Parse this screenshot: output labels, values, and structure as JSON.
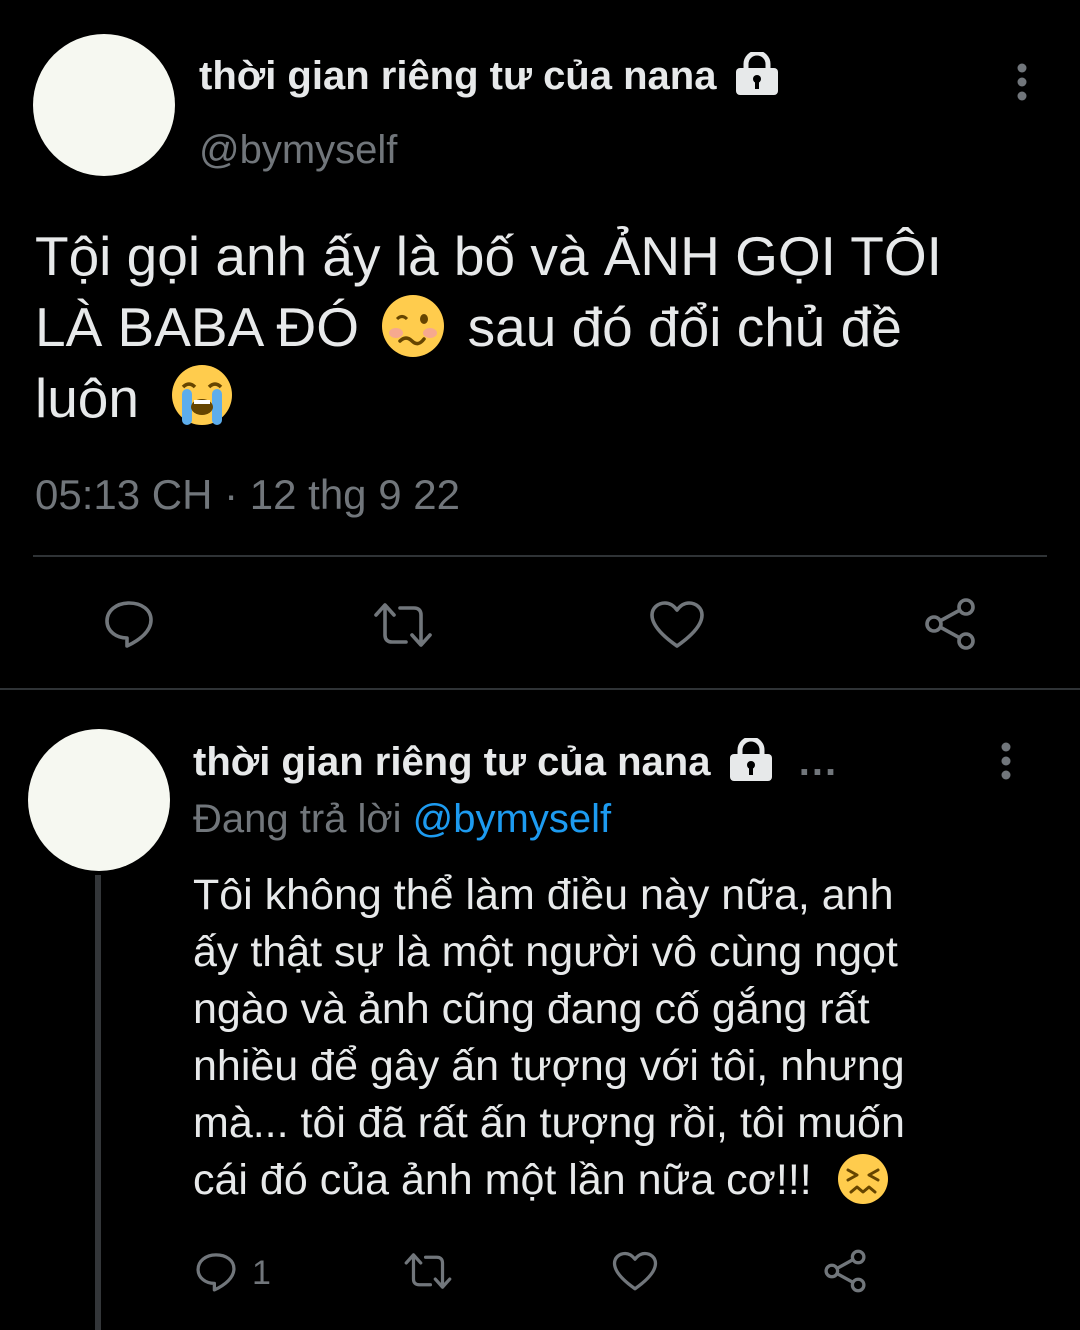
{
  "main_tweet": {
    "display_name": "thời gian riêng tư của nana",
    "handle": "@bymyself",
    "text_line1": "Tội gọi anh ấy là bố và ẢNH GỌI TÔI",
    "text_line2_a": "LÀ BABA ĐÓ",
    "text_line2_b": "sau đó đổi chủ đề",
    "text_line3": "luôn",
    "timestamp": "05:13 CH · 12 thg 9 22",
    "emojis": [
      "woozy-face",
      "loudly-crying-face"
    ]
  },
  "reply_tweet": {
    "display_name": "thời gian riêng tư của nana",
    "more_label": "...",
    "replying_prefix": "Đang trả lời",
    "replying_to": "@bymyself",
    "lines": [
      "Tôi không thể làm điều này nữa, anh",
      "ấy thật sự là một người vô cùng ngọt",
      "ngào và ảnh cũng đang cố gắng rất",
      "nhiều để gây ấn tượng với tôi, nhưng",
      "mà... tôi đã rất ấn tượng rồi, tôi muốn",
      "cái đó của ảnh một lần nữa cơ!!!"
    ],
    "reply_count": "1",
    "emoji": "confounded-face"
  },
  "colors": {
    "background": "#000000",
    "text": "#e7e9ea",
    "muted": "#71767b",
    "link": "#1d9bf0",
    "avatar": "#f6f8f1"
  }
}
